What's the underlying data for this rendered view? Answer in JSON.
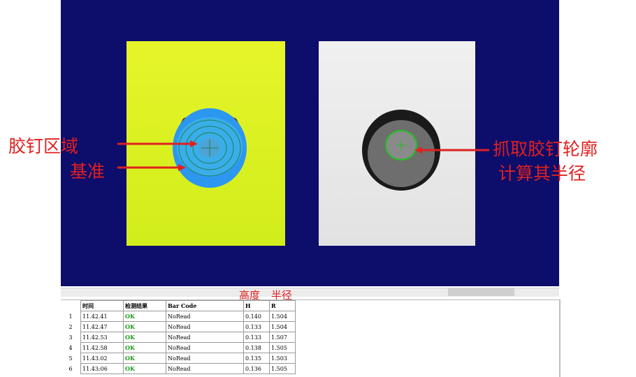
{
  "annotations": {
    "glue_zone": "胶钉区域",
    "baseline": "基准",
    "grab_line1": "抓取胶钉轮廓",
    "grab_line2": "计算其半径"
  },
  "column_highlight": {
    "height": "高度",
    "radius": "半径"
  },
  "table": {
    "headers": [
      "时间",
      "检测结果",
      "Bar Code",
      "H",
      "R"
    ],
    "rows": [
      {
        "idx": "1",
        "time": "11.42.41",
        "result": "OK",
        "barcode": "NoRead",
        "h": "0.140",
        "r": "1.504"
      },
      {
        "idx": "2",
        "time": "11.42.47",
        "result": "OK",
        "barcode": "NoRead",
        "h": "0.133",
        "r": "1.504"
      },
      {
        "idx": "3",
        "time": "11.42.53",
        "result": "OK",
        "barcode": "NoRead",
        "h": "0.133",
        "r": "1.507"
      },
      {
        "idx": "4",
        "time": "11.42.58",
        "result": "OK",
        "barcode": "NoRead",
        "h": "0.138",
        "r": "1.505"
      },
      {
        "idx": "5",
        "time": "11.43.02",
        "result": "OK",
        "barcode": "NoRead",
        "h": "0.135",
        "r": "1.503"
      },
      {
        "idx": "6",
        "time": "11.43:06",
        "result": "OK",
        "barcode": "NoRead",
        "h": "0.136",
        "r": "1.505"
      }
    ]
  },
  "colors": {
    "viewer_bg": "#0d0d6b",
    "annotation": "#e02020",
    "ok": "#1a9a1a",
    "contour": "#22c022"
  }
}
